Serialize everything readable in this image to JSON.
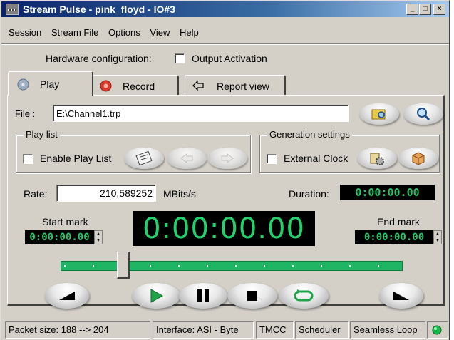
{
  "window": {
    "title": "Stream Pulse - pink_floyd - IO#3",
    "buttons": {
      "minimize": "_",
      "maximize": "□",
      "close": "×"
    }
  },
  "menu": [
    "Session",
    "Stream File",
    "Options",
    "View",
    "Help"
  ],
  "hardware": {
    "label": "Hardware configuration:",
    "output_activation": "Output Activation",
    "output_activation_checked": false
  },
  "tabs": [
    {
      "label": "Play",
      "icon": "disc-icon",
      "active": true
    },
    {
      "label": "Record",
      "icon": "record-icon",
      "active": false
    },
    {
      "label": "Report view",
      "icon": "refresh-arrows-icon",
      "active": false
    }
  ],
  "file": {
    "label": "File :",
    "value": "E:\\Channel1.trp"
  },
  "playlist": {
    "group_label": "Play list",
    "enable_label": "Enable Play List",
    "enabled": false
  },
  "generation": {
    "group_label": "Generation settings",
    "external_clock_label": "External Clock",
    "external_clock": false
  },
  "rate": {
    "label": "Rate:",
    "value": "210,589252",
    "unit": "MBits/s"
  },
  "duration": {
    "label": "Duration:",
    "value": "0:00:00.00"
  },
  "start_mark": {
    "label": "Start mark",
    "value": "0:00:00.00"
  },
  "end_mark": {
    "label": "End mark",
    "value": "0:00:00.00"
  },
  "timer": {
    "value": "0:00:00.00"
  },
  "slider": {
    "position": 0.17
  },
  "status": {
    "packet_size": "Packet size: 188 --> 204",
    "interface": "Interface: ASI - Byte",
    "tmcc": "TMCC",
    "scheduler": "Scheduler",
    "seamless_loop": "Seamless Loop"
  },
  "colors": {
    "lcd_green": "#22d36b",
    "slider_green": "#1fb564",
    "title_blue": "#0a246a"
  }
}
